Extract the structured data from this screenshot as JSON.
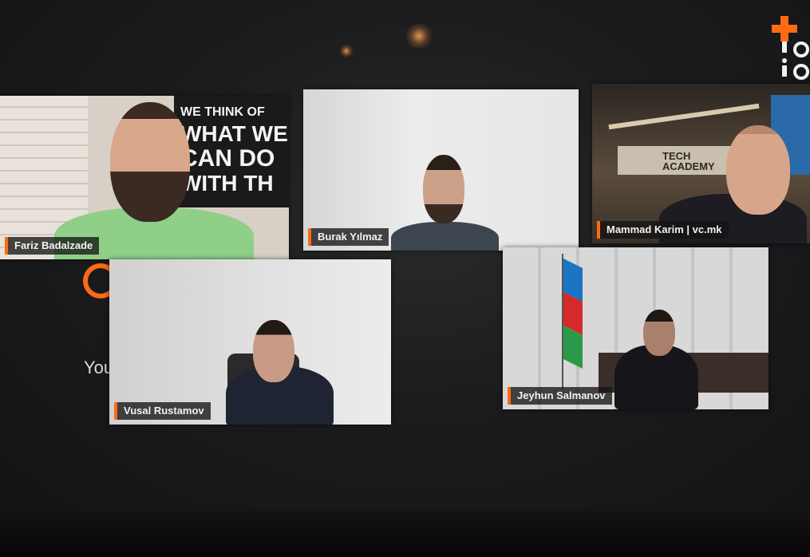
{
  "background": {
    "partial_text": "You"
  },
  "participants": [
    {
      "name": "Fariz Badalzade",
      "wall_text": [
        "WE THINK OF",
        "WHAT WE",
        "CAN DO",
        "WITH TH"
      ]
    },
    {
      "name": "Burak Yılmaz"
    },
    {
      "name": "Mammad Karim | vc.mk",
      "sign_text": [
        "TECH",
        "ACADEMY"
      ]
    },
    {
      "name": "Vusal Rustamov"
    },
    {
      "name": "Jeyhun Salmanov"
    }
  ],
  "colors": {
    "accent": "#ff6a13",
    "name_tag_bg": "#141416",
    "screen_bg": "#1b1c1e"
  },
  "icons": [
    "plus-logo-icon",
    "azerbaijan-flag"
  ]
}
